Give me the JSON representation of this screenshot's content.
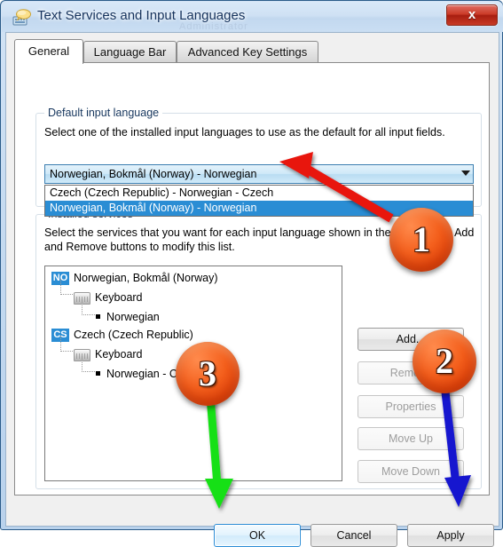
{
  "window": {
    "title": "Text Services and Input Languages",
    "icon": "language-bubble-keyboard-icon",
    "close_label": "x",
    "ghost_text": "Administrator"
  },
  "tabs": [
    {
      "label": "General",
      "selected": true
    },
    {
      "label": "Language Bar",
      "selected": false
    },
    {
      "label": "Advanced Key Settings",
      "selected": false
    }
  ],
  "default_input_language": {
    "legend": "Default input language",
    "description": "Select one of the installed input languages to use as the default for all input fields.",
    "selected_value": "Norwegian, Bokmål (Norway) - Norwegian",
    "options": [
      {
        "label": "Czech (Czech Republic) - Norwegian - Czech",
        "selected": false
      },
      {
        "label": "Norwegian, Bokmål (Norway) - Norwegian",
        "selected": true
      }
    ]
  },
  "installed_services": {
    "legend": "Installed services",
    "description": "Select the services that you want for each input language shown in the list. Use the Add and Remove buttons to modify this list.",
    "tree": [
      {
        "badge": "NO",
        "label": "Norwegian, Bokmål (Norway)",
        "group": "Keyboard",
        "item": "Norwegian"
      },
      {
        "badge": "CS",
        "label": "Czech (Czech Republic)",
        "group": "Keyboard",
        "item": "Norwegian - Czech"
      }
    ],
    "buttons": [
      {
        "label": "Add...",
        "enabled": true
      },
      {
        "label": "Remove",
        "enabled": false
      },
      {
        "label": "Properties",
        "enabled": false
      },
      {
        "label": "Move Up",
        "enabled": false
      },
      {
        "label": "Move Down",
        "enabled": false
      }
    ]
  },
  "dialog_buttons": [
    {
      "label": "OK",
      "default": true
    },
    {
      "label": "Cancel",
      "default": false
    },
    {
      "label": "Apply",
      "default": false
    }
  ],
  "annotations": [
    {
      "number": "1",
      "arrow_color": "#e8120c",
      "points_to": "Czech (Czech Republic) - Norwegian - Czech"
    },
    {
      "number": "2",
      "arrow_color": "#1414cf",
      "points_to": "Apply"
    },
    {
      "number": "3",
      "arrow_color": "#18e018",
      "points_to": "OK"
    }
  ],
  "colors": {
    "accent": "#2a8dd4",
    "title_text": "#15325e",
    "badge_orange": "#f4601d"
  }
}
